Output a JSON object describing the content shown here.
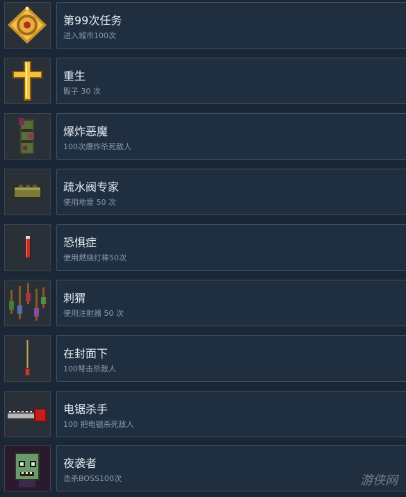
{
  "achievements": [
    {
      "title": "第99次任务",
      "desc": "进入城市100次",
      "icon": "golden-medallion-icon"
    },
    {
      "title": "重生",
      "desc": "骰子 30 次",
      "icon": "golden-cross-icon"
    },
    {
      "title": "爆炸恶魔",
      "desc": "100次爆炸杀死敌人",
      "icon": "explosive-bundle-icon"
    },
    {
      "title": "疏水阀专家",
      "desc": "使用地雷 50 次",
      "icon": "landmine-icon"
    },
    {
      "title": "恐惧症",
      "desc": "使用燃烧灯棒50次",
      "icon": "flare-stick-icon"
    },
    {
      "title": "刺猬",
      "desc": "使用注射器 50 次",
      "icon": "syringes-icon"
    },
    {
      "title": "在封面下",
      "desc": "100弩击杀敌人",
      "icon": "crossbow-bolt-icon"
    },
    {
      "title": "电锯杀手",
      "desc": "100 把电锯杀死敌人",
      "icon": "chainsaw-icon"
    },
    {
      "title": "夜袭者",
      "desc": "击杀BOSS100次",
      "icon": "zombie-face-icon"
    }
  ],
  "watermark": "游侠网",
  "colors": {
    "background": "#1b2735",
    "panel": "#202f40",
    "title": "#e4eaf0",
    "desc": "#8b9bab"
  }
}
